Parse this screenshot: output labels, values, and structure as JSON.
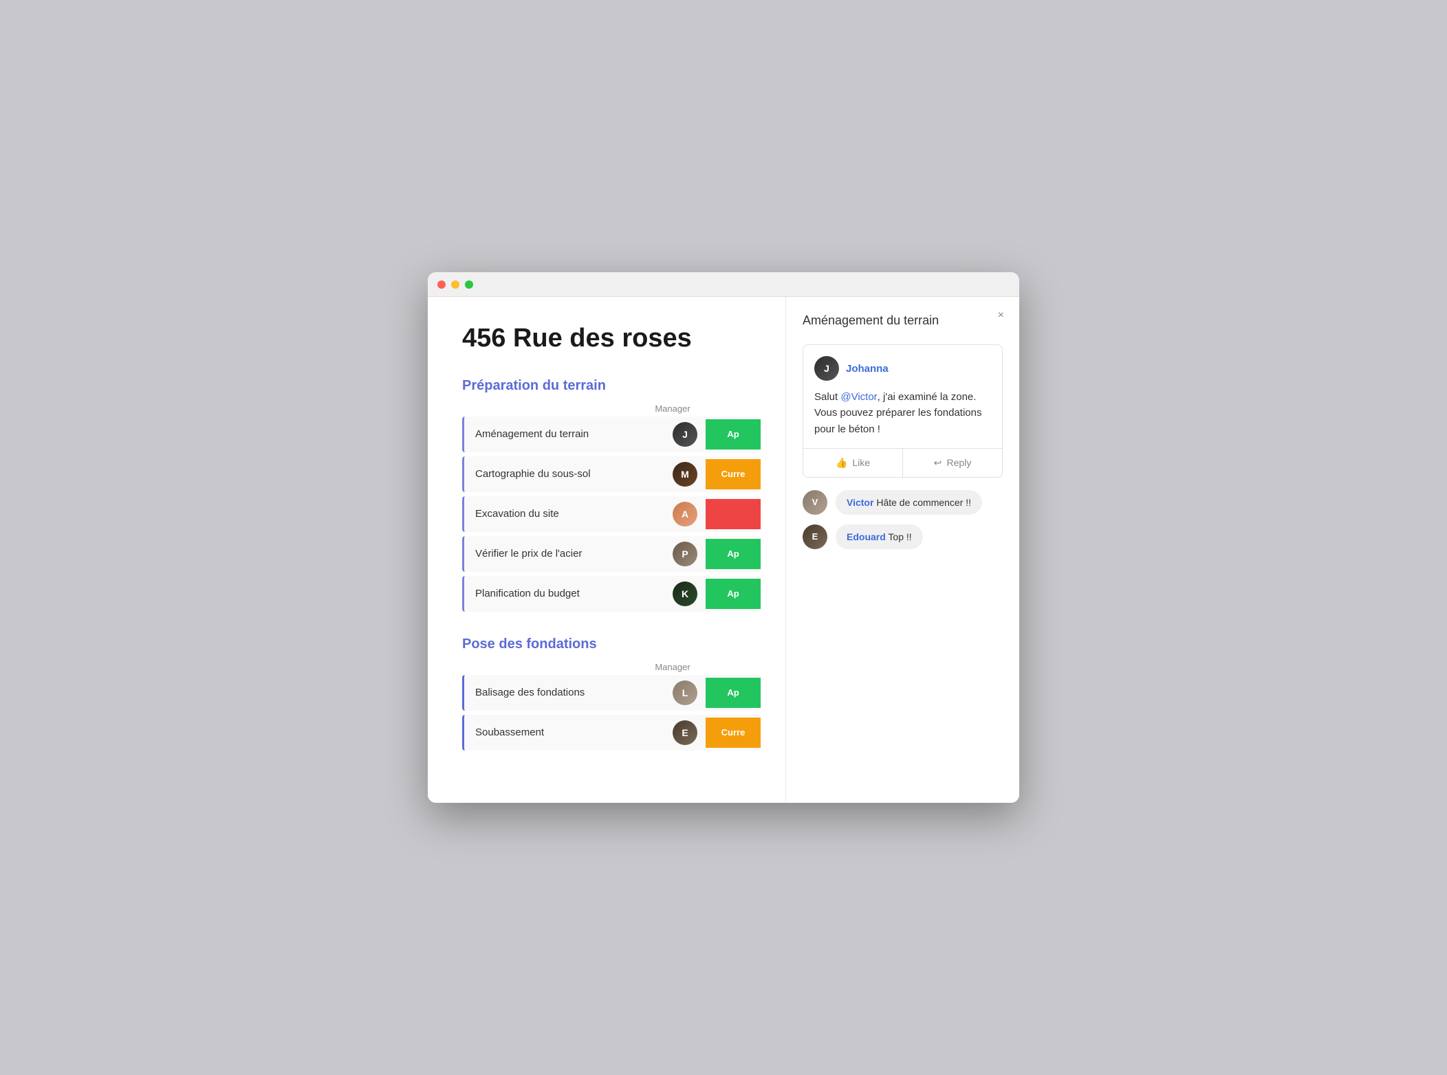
{
  "window": {
    "title": "456 Rue des roses"
  },
  "page": {
    "title": "456 Rue des roses"
  },
  "sections": [
    {
      "id": "preparation",
      "title": "Préparation du terrain",
      "manager_label": "Manager",
      "tasks": [
        {
          "label": "Aménagement du terrain",
          "avatar_id": "1",
          "status": "Ap",
          "status_class": "status-green"
        },
        {
          "label": "Cartographie du sous-sol",
          "avatar_id": "2",
          "status": "Curre",
          "status_class": "status-orange"
        },
        {
          "label": "Excavation du site",
          "avatar_id": "3",
          "status": "",
          "status_class": "status-red"
        },
        {
          "label": "Vérifier le prix de l'acier",
          "avatar_id": "4",
          "status": "Ap",
          "status_class": "status-green"
        },
        {
          "label": "Planification du budget",
          "avatar_id": "5",
          "status": "Ap",
          "status_class": "status-green"
        }
      ]
    },
    {
      "id": "fondations",
      "title": "Pose des fondations",
      "manager_label": "Manager",
      "tasks": [
        {
          "label": "Balisage des fondations",
          "avatar_id": "6",
          "status": "Ap",
          "status_class": "status-green"
        },
        {
          "label": "Soubassement",
          "avatar_id": "7",
          "status": "Curre",
          "status_class": "status-orange"
        }
      ]
    }
  ],
  "panel": {
    "title": "Aménagement du terrain",
    "close_label": "×",
    "comment": {
      "author": "Johanna",
      "body_prefix": "Salut ",
      "mention": "@Victor",
      "body_suffix": ", j'ai examiné la zone. Vous pouvez préparer les fondations pour le béton !",
      "like_label": "Like",
      "reply_label": "Reply"
    },
    "replies": [
      {
        "author": "Victor",
        "text": "Hâte de commencer !!",
        "avatar_class": "avatar-victor"
      },
      {
        "author": "Edouard",
        "text": "Top !!",
        "avatar_class": "avatar-edouard"
      }
    ]
  },
  "icons": {
    "like": "👍",
    "reply": "↩"
  }
}
